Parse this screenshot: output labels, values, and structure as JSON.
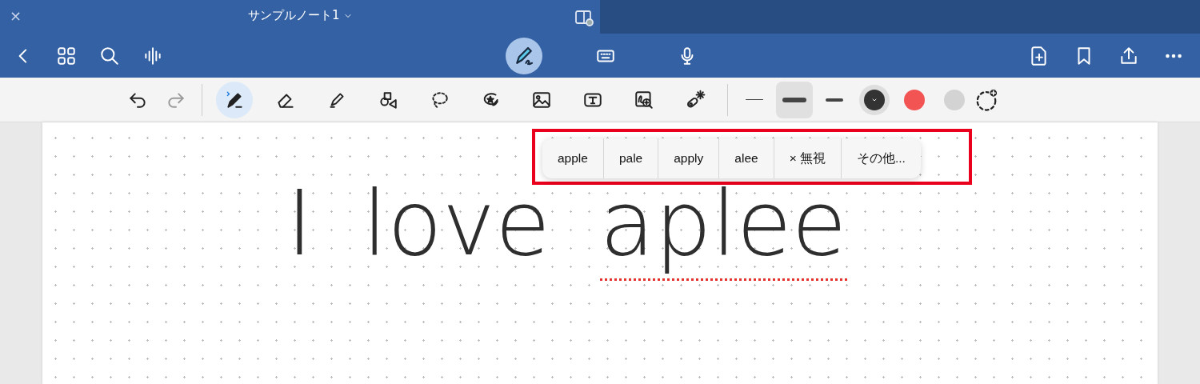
{
  "window": {
    "title": "サンプルノート1",
    "close_glyph": "×"
  },
  "modes": [
    {
      "kind": "pen",
      "selected": true
    },
    {
      "kind": "keyboard",
      "selected": false
    },
    {
      "kind": "mic",
      "selected": false
    }
  ],
  "tools": [
    {
      "kind": "pen",
      "selected": true
    },
    {
      "kind": "eraser",
      "selected": false
    },
    {
      "kind": "highlighter",
      "selected": false
    },
    {
      "kind": "shapes",
      "selected": false
    },
    {
      "kind": "lasso",
      "selected": false
    },
    {
      "kind": "sticker",
      "selected": false
    },
    {
      "kind": "image",
      "selected": false
    },
    {
      "kind": "textbox",
      "selected": false
    },
    {
      "kind": "image-search",
      "selected": false
    },
    {
      "kind": "laser",
      "selected": false
    }
  ],
  "widths": [
    {
      "kind": "thin",
      "selected": false
    },
    {
      "kind": "medium",
      "selected": true
    },
    {
      "kind": "thick",
      "selected": false
    }
  ],
  "colors": [
    {
      "color": "#333333",
      "selected": true
    },
    {
      "color": "#f25353",
      "selected": false
    },
    {
      "color": "#d3d3d3",
      "selected": false
    }
  ],
  "suggestions": [
    "apple",
    "pale",
    "apply",
    "alee",
    "× 無視",
    "その他..."
  ],
  "ink": [
    {
      "text": "I",
      "misspelled": false
    },
    {
      "text": "love",
      "misspelled": false
    },
    {
      "text": "aplee",
      "misspelled": true
    }
  ]
}
